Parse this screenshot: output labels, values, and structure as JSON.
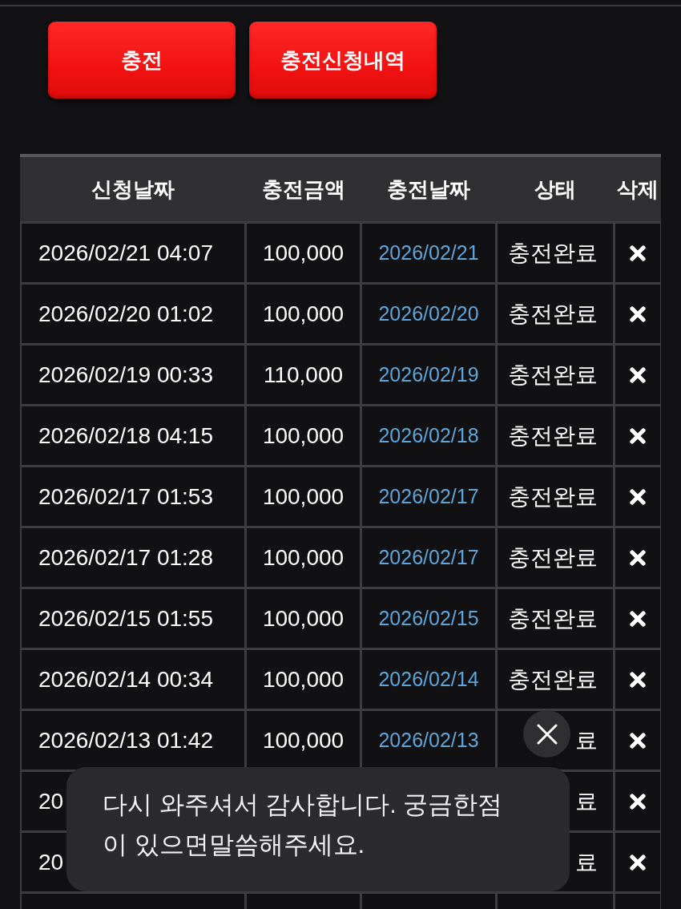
{
  "buttons": [
    {
      "label": "충전"
    },
    {
      "label": "충전신청내역"
    }
  ],
  "table": {
    "columns": [
      "신청날짜",
      "충전금액",
      "충전날짜",
      "상태",
      "삭제"
    ],
    "rows": [
      {
        "request_date": "2026/02/21 04:07",
        "amount": "100,000",
        "charge_date": "2026/02/21",
        "status": "충전완료"
      },
      {
        "request_date": "2026/02/20 01:02",
        "amount": "100,000",
        "charge_date": "2026/02/20",
        "status": "충전완료"
      },
      {
        "request_date": "2026/02/19 00:33",
        "amount": "110,000",
        "charge_date": "2026/02/19",
        "status": "충전완료"
      },
      {
        "request_date": "2026/02/18 04:15",
        "amount": "100,000",
        "charge_date": "2026/02/18",
        "status": "충전완료"
      },
      {
        "request_date": "2026/02/17 01:53",
        "amount": "100,000",
        "charge_date": "2026/02/17",
        "status": "충전완료"
      },
      {
        "request_date": "2026/02/17 01:28",
        "amount": "100,000",
        "charge_date": "2026/02/17",
        "status": "충전완료"
      },
      {
        "request_date": "2026/02/15 01:55",
        "amount": "100,000",
        "charge_date": "2026/02/15",
        "status": "충전완료"
      },
      {
        "request_date": "2026/02/14 00:34",
        "amount": "100,000",
        "charge_date": "2026/02/14",
        "status": "충전완료"
      },
      {
        "request_date": "2026/02/13 01:42",
        "amount": "100,000",
        "charge_date": "2026/02/13",
        "status": "료"
      },
      {
        "request_date": "20",
        "status": "료"
      },
      {
        "request_date": "20",
        "status": "료"
      }
    ]
  },
  "toast": {
    "message": "다시 와주셔서 감사합니다. 궁금한점이 있으면말씀해주세요."
  }
}
